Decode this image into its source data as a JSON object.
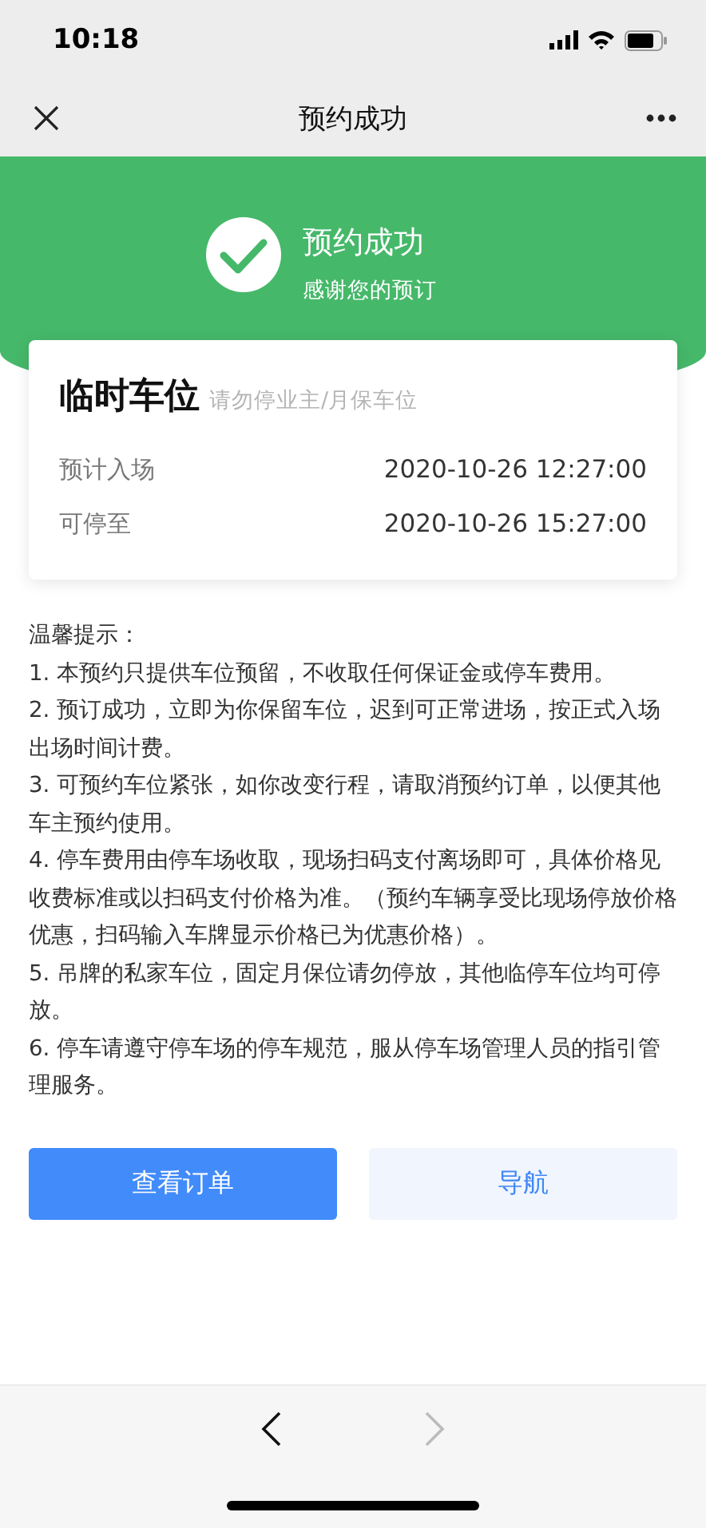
{
  "status_bar": {
    "time": "10:18"
  },
  "nav_bar": {
    "title": "预约成功"
  },
  "banner": {
    "title": "预约成功",
    "subtitle": "感谢您的预订"
  },
  "card": {
    "title": "临时车位",
    "note": "请勿停业主/月保车位",
    "rows": [
      {
        "label": "预计入场",
        "value": "2020-10-26 12:27:00"
      },
      {
        "label": "可停至",
        "value": "2020-10-26 15:27:00"
      }
    ]
  },
  "tips": {
    "heading": "温馨提示：",
    "items": [
      "1. 本预约只提供车位预留，不收取任何保证金或停车费用。",
      "2. 预订成功，立即为你保留车位，迟到可正常进场，按正式入场出场时间计费。",
      "3. 可预约车位紧张，如你改变行程，请取消预约订单，以便其他车主预约使用。",
      "4. 停车费用由停车场收取，现场扫码支付离场即可，具体价格见收费标准或以扫码支付价格为准。（预约车辆享受比现场停放价格优惠，扫码输入车牌显示价格已为优惠价格）。",
      "5. 吊牌的私家车位，固定月保位请勿停放，其他临停车位均可停放。",
      "6. 停车请遵守停车场的停车规范，服从停车场管理人员的指引管理服务。"
    ]
  },
  "buttons": [
    {
      "label": "查看订单",
      "kind": "primary"
    },
    {
      "label": "导航",
      "kind": "secondary"
    }
  ],
  "toolbar": {
    "back": {
      "disabled": false
    },
    "forward": {
      "disabled": true
    }
  }
}
